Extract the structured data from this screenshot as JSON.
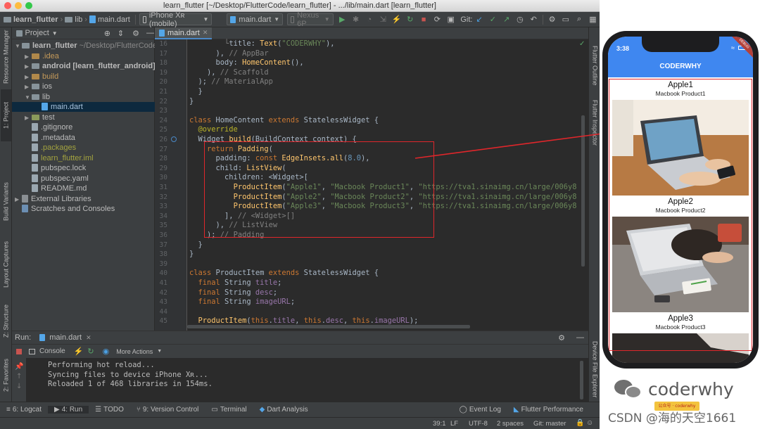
{
  "window": {
    "title": "learn_flutter [~/Desktop/FlutterCode/learn_flutter] - .../lib/main.dart [learn_flutter]"
  },
  "navbar": {
    "crumb_project": "learn_flutter",
    "crumb_lib": "lib",
    "crumb_file": "main.dart",
    "device_combo": "iPhone Xʀ (mobile)",
    "run_config": "main.dart",
    "emulator_combo": "Nexus 6P",
    "git_label": "Git:"
  },
  "left_strip": {
    "resource_manager": "Resource Manager",
    "project": "1: Project",
    "build_variants": "Build Variants",
    "layout_captures": "Layout Captures",
    "structure": "Z: Structure",
    "favorites": "2: Favorites"
  },
  "project_panel": {
    "header": "Project",
    "tree": [
      {
        "label": "learn_flutter",
        "suffix": " ~/Desktop/FlutterCode/",
        "indent": 0,
        "kind": "folder",
        "expanded": true,
        "bold": true
      },
      {
        "label": ".idea",
        "indent": 1,
        "kind": "folder-orange",
        "expanded": false
      },
      {
        "label": "android [learn_flutter_android]",
        "indent": 1,
        "kind": "folder",
        "expanded": false,
        "bold": true
      },
      {
        "label": "build",
        "indent": 1,
        "kind": "folder-orange",
        "expanded": false
      },
      {
        "label": "ios",
        "indent": 1,
        "kind": "folder",
        "expanded": false
      },
      {
        "label": "lib",
        "indent": 1,
        "kind": "folder",
        "expanded": true
      },
      {
        "label": "main.dart",
        "indent": 2,
        "kind": "dart",
        "selected": true
      },
      {
        "label": "test",
        "indent": 1,
        "kind": "folder-green",
        "expanded": false
      },
      {
        "label": ".gitignore",
        "indent": 1,
        "kind": "file"
      },
      {
        "label": ".metadata",
        "indent": 1,
        "kind": "file"
      },
      {
        "label": ".packages",
        "indent": 1,
        "kind": "file-yellow"
      },
      {
        "label": "learn_flutter.iml",
        "indent": 1,
        "kind": "file-yellow"
      },
      {
        "label": "pubspec.lock",
        "indent": 1,
        "kind": "file"
      },
      {
        "label": "pubspec.yaml",
        "indent": 1,
        "kind": "file"
      },
      {
        "label": "README.md",
        "indent": 1,
        "kind": "file"
      },
      {
        "label": "External Libraries",
        "indent": 0,
        "kind": "lib",
        "expanded": false
      },
      {
        "label": "Scratches and Consoles",
        "indent": 0,
        "kind": "scratch"
      }
    ]
  },
  "editor": {
    "tab": "main.dart",
    "lines": [
      {
        "n": "16",
        "html": "        <span class='cm'>└</span>title: <span class='fn'>Text</span>(<span class='st'>\"CODERWHY\"</span>),"
      },
      {
        "n": "17",
        "html": "      ), <span class='cm'>// AppBar</span>"
      },
      {
        "n": "18",
        "html": "      body: <span class='fn'>HomeContent</span>(),"
      },
      {
        "n": "19",
        "html": "    ), <span class='cm'>// Scaffold</span>"
      },
      {
        "n": "20",
        "html": "  ); <span class='cm'>// MaterialApp</span>"
      },
      {
        "n": "21",
        "html": "  }"
      },
      {
        "n": "22",
        "html": "}"
      },
      {
        "n": "23",
        "html": ""
      },
      {
        "n": "24",
        "html": "<span class='kw'>class</span> HomeContent <span class='kw'>extends</span> StatelessWidget {"
      },
      {
        "n": "25",
        "html": "  <span class='an'>@override</span>"
      },
      {
        "n": "26",
        "html": "  Widget <span class='fn'>build</span>(BuildContext context) {"
      },
      {
        "n": "27",
        "html": "    <span class='kw'>return</span> <span class='fn'>Padding</span>("
      },
      {
        "n": "28",
        "html": "      padding: <span class='kw'>const</span> <span class='fn'>EdgeInsets.all</span>(<span class='nm'>8.0</span>),"
      },
      {
        "n": "29",
        "html": "      child: <span class='fn'>ListView</span>("
      },
      {
        "n": "30",
        "html": "        children: &lt;Widget&gt;["
      },
      {
        "n": "31",
        "html": "          <span class='fn'>ProductItem</span>(<span class='st'>\"Apple1\"</span>, <span class='st'>\"Macbook Product1\"</span>, <span class='st'>\"https://tva1.sinaimg.cn/large/006y8</span>"
      },
      {
        "n": "32",
        "html": "          <span class='fn'>ProductItem</span>(<span class='st'>\"Apple2\"</span>, <span class='st'>\"Macbook Product2\"</span>, <span class='st'>\"https://tva1.sinaimg.cn/large/006y8</span>"
      },
      {
        "n": "33",
        "html": "          <span class='fn'>ProductItem</span>(<span class='st'>\"Apple3\"</span>, <span class='st'>\"Macbook Product3\"</span>, <span class='st'>\"https://tva1.sinaimg.cn/large/006y8</span>"
      },
      {
        "n": "34",
        "html": "        ], <span class='cm'>// &lt;Widget&gt;[]</span>"
      },
      {
        "n": "35",
        "html": "      ), <span class='cm'>// ListView</span>"
      },
      {
        "n": "36",
        "html": "    ); <span class='cm'>// Padding</span>"
      },
      {
        "n": "37",
        "html": "  }"
      },
      {
        "n": "38",
        "html": "}"
      },
      {
        "n": "39",
        "html": ""
      },
      {
        "n": "40",
        "html": "<span class='kw'>class</span> ProductItem <span class='kw'>extends</span> StatelessWidget {"
      },
      {
        "n": "41",
        "html": "  <span class='kw'>final</span> String <span class='pu'>title</span>;"
      },
      {
        "n": "42",
        "html": "  <span class='kw'>final</span> String <span class='pu'>desc</span>;"
      },
      {
        "n": "43",
        "html": "  <span class='kw'>final</span> String <span class='pu'>imageURL</span>;"
      },
      {
        "n": "44",
        "html": ""
      },
      {
        "n": "45",
        "html": "  <span class='fn'>ProductItem</span>(<span class='kw'>this</span>.<span class='pu'>title</span>, <span class='kw'>this</span>.<span class='pu'>desc</span>, <span class='kw'>this</span>.<span class='pu'>imageURL</span>);"
      }
    ]
  },
  "right_strip": {
    "flutter_outline": "Flutter Outline",
    "flutter_inspector": "Flutter Inspector",
    "device_file_explorer": "Device File Explorer"
  },
  "run_panel": {
    "label": "Run:",
    "tab": "main.dart",
    "console_tab": "Console",
    "more_actions": "More Actions",
    "output": [
      "Performing hot reload...",
      "Syncing files to device iPhone Xʀ...",
      "Reloaded 1 of 468 libraries in 154ms."
    ]
  },
  "bottom_tools": {
    "logcat": "6: Logcat",
    "run": "4: Run",
    "todo": "TODO",
    "version_control": "9: Version Control",
    "terminal": "Terminal",
    "dart_analysis": "Dart Analysis",
    "event_log": "Event Log",
    "flutter_performance": "Flutter Performance"
  },
  "status": {
    "position": "39:1",
    "line_sep": "LF",
    "encoding": "UTF-8",
    "indent": "2 spaces",
    "git": "Git: master"
  },
  "phone": {
    "time": "3:38",
    "appbar_title": "CODERWHY",
    "items": [
      {
        "title": "Apple1",
        "desc": "Macbook Product1"
      },
      {
        "title": "Apple2",
        "desc": "Macbook Product2"
      },
      {
        "title": "Apple3",
        "desc": "Macbook Product3"
      }
    ],
    "debug_ribbon": "DEBUG"
  },
  "watermark": {
    "brand": "coderwhy",
    "badge": "公众号 · coderwhy",
    "csdn": "CSDN @海的天空1661"
  },
  "colors": {
    "ide_bg": "#2b2b2b",
    "panel": "#3c3f41",
    "keyword": "#cc7832",
    "function": "#ffc66d",
    "string": "#6a8759",
    "highlight": "#e0262b",
    "appbar": "#3f87f0"
  }
}
